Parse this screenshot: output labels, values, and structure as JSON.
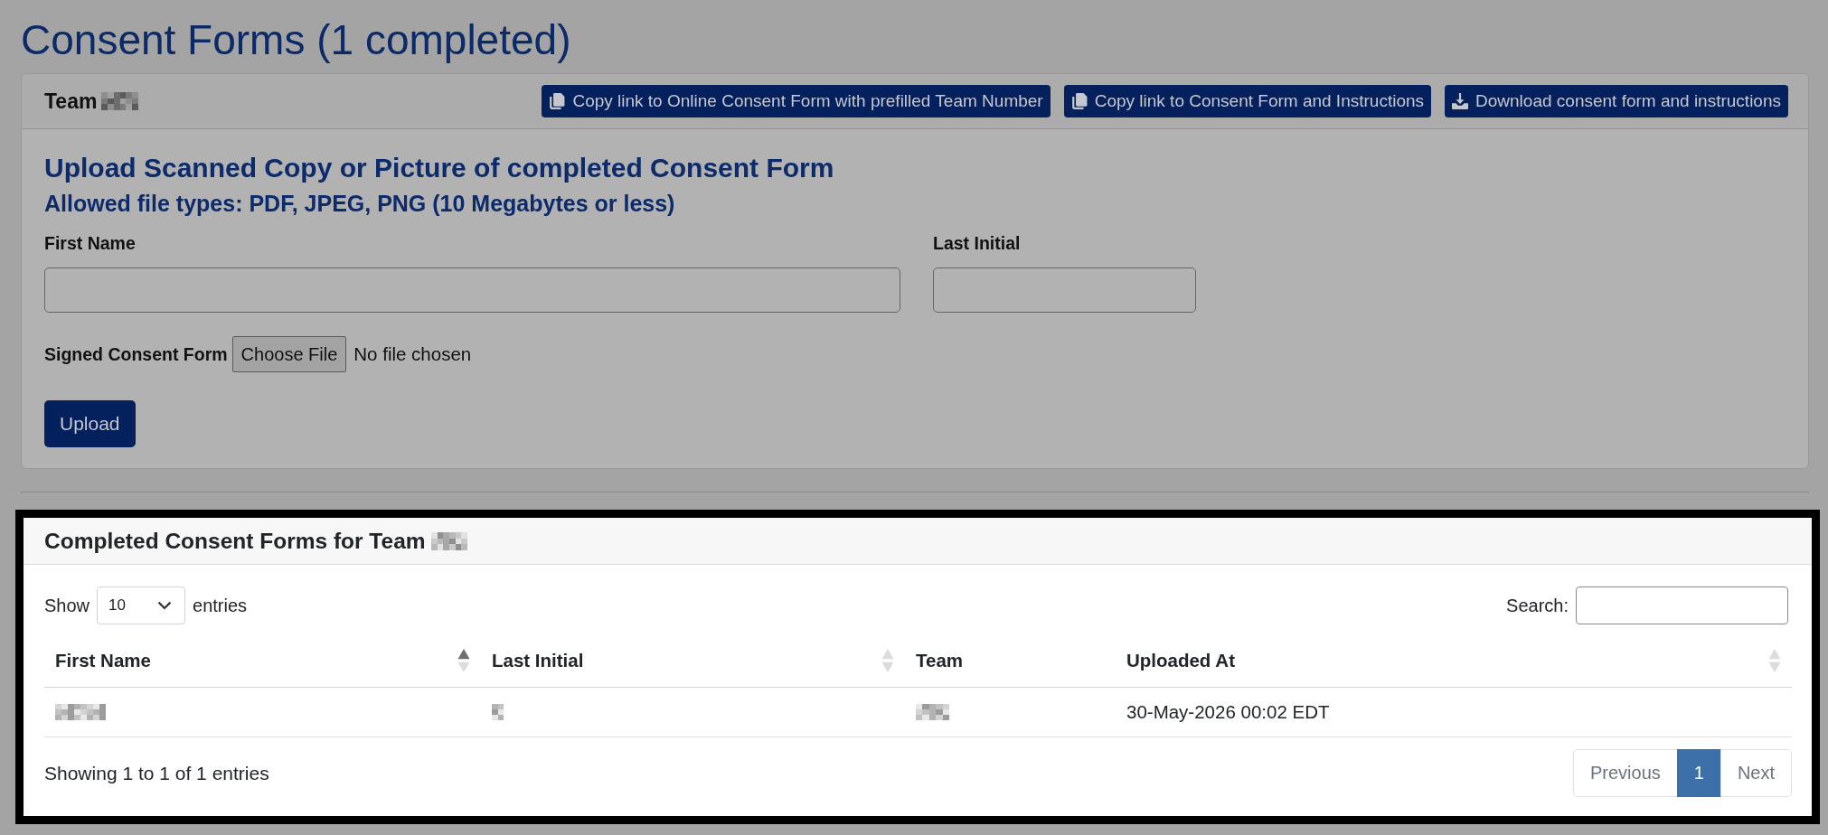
{
  "page": {
    "title": "Consent Forms (1 completed)"
  },
  "team_card": {
    "label": "Team",
    "label_redacted": true,
    "actions": [
      {
        "kind": "copy",
        "label": "Copy link to Online Consent Form with prefilled Team Number"
      },
      {
        "kind": "copy",
        "label": "Copy link to Consent Form and Instructions"
      },
      {
        "kind": "download",
        "label": "Download consent form and instructions"
      }
    ]
  },
  "upload_form": {
    "heading": "Upload Scanned Copy or Picture of completed Consent Form",
    "subheading": "Allowed file types: PDF, JPEG, PNG (10 Megabytes or less)",
    "fields": [
      {
        "label": "First Name"
      },
      {
        "label": "Last Initial"
      }
    ],
    "file": {
      "label": "Signed Consent Form",
      "button": "Choose File",
      "status": "No file chosen"
    },
    "submit": "Upload"
  },
  "completed_forms": {
    "highlighted": true,
    "title": "Completed Consent Forms for Team",
    "title_redacted": true,
    "length_menu": {
      "before": "Show",
      "value": "10",
      "after": "entries"
    },
    "search": {
      "label": "Search:"
    },
    "columns": [
      {
        "label": "First Name",
        "sortable": true,
        "sorted": true
      },
      {
        "label": "Last Initial",
        "sortable": true,
        "sorted": false
      },
      {
        "label": "Team",
        "sortable": false
      },
      {
        "label": "Uploaded At",
        "sortable": true,
        "sorted": false
      }
    ],
    "rows": [
      {
        "cells": [
          {
            "kind": "redacted"
          },
          {
            "kind": "redacted"
          },
          {
            "kind": "redacted"
          },
          {
            "kind": "text",
            "text": "30-May-2026 00:02 EDT"
          }
        ]
      }
    ],
    "info": "Showing 1 to 1 of 1 entries",
    "pagination": {
      "previous": {
        "label": "Previous",
        "disabled": true
      },
      "pages": [
        {
          "label": "1",
          "selected": true
        }
      ],
      "next": {
        "label": "Next",
        "disabled": true
      }
    }
  }
}
